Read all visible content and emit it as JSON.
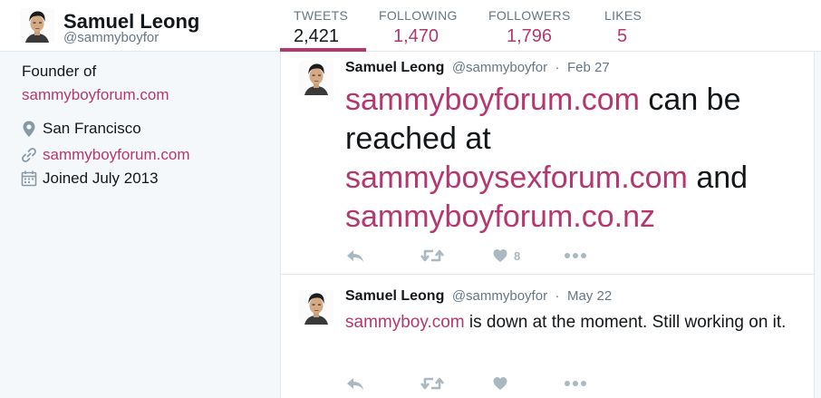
{
  "header": {
    "name": "Samuel Leong",
    "handle": "@sammyboyfor",
    "stats": [
      {
        "label": "TWEETS",
        "value": "2,421"
      },
      {
        "label": "FOLLOWING",
        "value": "1,470"
      },
      {
        "label": "FOLLOWERS",
        "value": "1,796"
      },
      {
        "label": "LIKES",
        "value": "5"
      }
    ]
  },
  "profile": {
    "bio_line1": "Founder of",
    "bio_link": "sammyboyforum.com",
    "location": "San Francisco",
    "website": "sammyboyforum.com",
    "joined": "Joined July 2013"
  },
  "tweets": [
    {
      "name": "Samuel Leong",
      "handle": "@sammyboyfor",
      "dot": "·",
      "date": "Feb 27",
      "parts": {
        "link1": "sammyboyforum.com",
        "text1": " can be reached at ",
        "link2": "sammyboysexforum.com",
        "text2": " and ",
        "link3": "sammyboyforum.co.nz"
      },
      "like_count": "8"
    },
    {
      "name": "Samuel Leong",
      "handle": "@sammyboyfor",
      "dot": "·",
      "date": "May 22",
      "parts": {
        "link1": "sammyboy.com",
        "text1": " is down at the moment. Still working on it."
      },
      "like_count": ""
    }
  ],
  "icons": {
    "reply": "reply-icon",
    "retweet": "retweet-icon",
    "like": "heart-icon",
    "more": "more-icon",
    "location": "location-pin-icon",
    "link": "link-icon",
    "calendar": "calendar-icon"
  },
  "colors": {
    "accent": "#b5376f",
    "secondary_text": "#657786",
    "icon_gray": "#aab8c2",
    "background": "#f5f8fa"
  }
}
